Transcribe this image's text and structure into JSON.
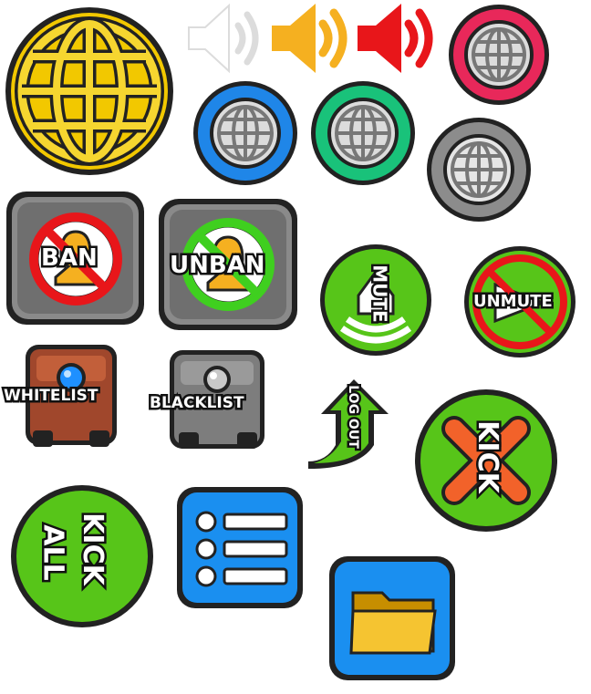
{
  "buttons": {
    "ban": {
      "label": "BAN"
    },
    "unban": {
      "label": "UNBAN"
    },
    "mute": {
      "label": "MUTE"
    },
    "unmute": {
      "label": "UNMUTE"
    },
    "whitelist": {
      "label": "WHITELIST"
    },
    "blacklist": {
      "label": "BLACKLIST"
    },
    "logout": {
      "label": "LOG OUT"
    },
    "kick": {
      "label": "KICK"
    },
    "kick_all": {
      "label_line1": "KICK",
      "label_line2": "ALL"
    }
  },
  "icons": {
    "globe_large": "globe-icon",
    "speaker_white": "speaker-icon",
    "speaker_orange": "speaker-icon",
    "speaker_red": "speaker-icon",
    "globe_pink": "globe-icon",
    "globe_blue": "globe-icon",
    "globe_teal": "globe-icon",
    "globe_gray": "globe-icon",
    "list": "list-icon",
    "folder": "folder-icon"
  },
  "colors": {
    "gold": "#f2c800",
    "pink": "#e8285a",
    "blue": "#1f86e8",
    "teal": "#19c27a",
    "gray": "#8c8c8c",
    "green": "#57c519",
    "red": "#e8161a",
    "orange": "#f5b020",
    "square_blue": "#1a8ff0"
  }
}
